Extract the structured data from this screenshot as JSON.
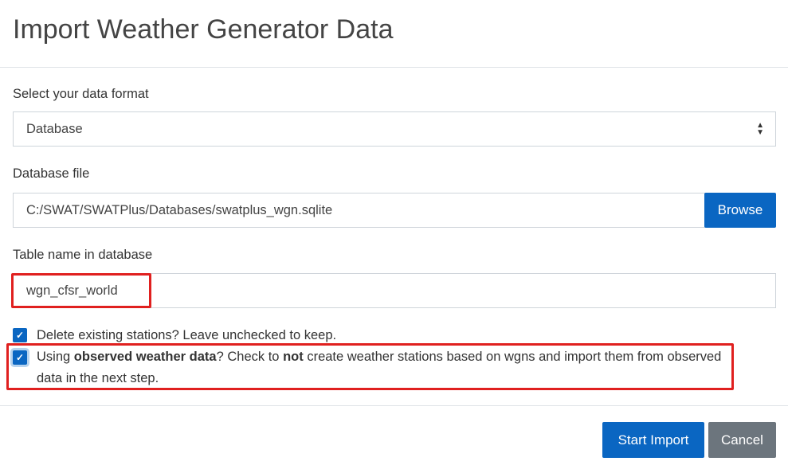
{
  "title": "Import Weather Generator Data",
  "format": {
    "label": "Select your data format",
    "value": "Database"
  },
  "dbfile": {
    "label": "Database file",
    "value": "C:/SWAT/SWATPlus/Databases/swatplus_wgn.sqlite",
    "browse": "Browse"
  },
  "table": {
    "label": "Table name in database",
    "value": "wgn_cfsr_world"
  },
  "delete": {
    "checked": true,
    "text": "Delete existing stations? Leave unchecked to keep."
  },
  "observed": {
    "checked": true,
    "t1": "Using ",
    "b1": "observed weather data",
    "t2": "? Check to ",
    "b2": "not",
    "t3": " create weather stations based on wgns and import them from observed data in the next step."
  },
  "buttons": {
    "start": "Start Import",
    "cancel": "Cancel"
  },
  "colors": {
    "primary": "#0a66c2",
    "secondary": "#6c757d",
    "highlight": "#e0201f"
  }
}
